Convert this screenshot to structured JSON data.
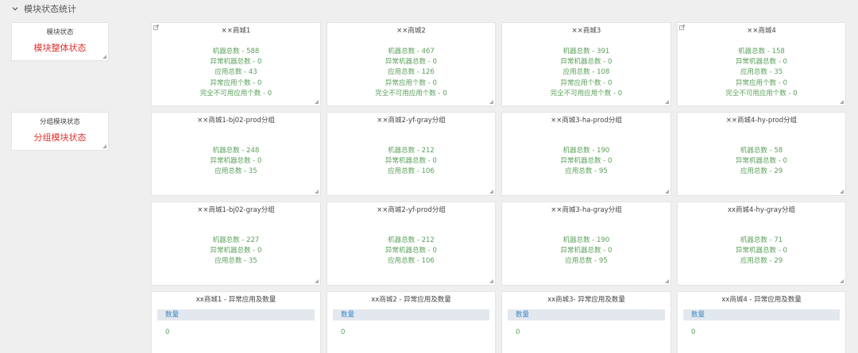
{
  "section": {
    "title": "模块状态统计"
  },
  "sidebar": [
    {
      "title": "模块状态",
      "value": "模块整体状态"
    },
    {
      "title": "分组模块状态",
      "value": "分组模块状态"
    }
  ],
  "row1": [
    {
      "title": "××商城1",
      "stats": [
        "机器总数 - 588",
        "异常机器总数 - 0",
        "应用总数 - 43",
        "异常应用个数 - 0",
        "完全不可用应用个数 - 0"
      ]
    },
    {
      "title": "××商城2",
      "stats": [
        "机器总数 - 467",
        "异常机器总数 - 0",
        "应用总数 - 126",
        "异常应用个数 - 0",
        "完全不可用应用个数 - 0"
      ]
    },
    {
      "title": "××商城3",
      "stats": [
        "机器总数 - 391",
        "异常机器总数 - 0",
        "应用总数 - 108",
        "异常应用个数 - 0",
        "完全不可用应用个数 - 0"
      ]
    },
    {
      "title": "××商城4",
      "stats": [
        "机器总数 - 158",
        "异常机器总数 - 0",
        "应用总数 - 35",
        "异常应用个数 - 0",
        "完全不可用应用个数 - 0"
      ]
    }
  ],
  "row2": [
    {
      "title": "××商城1-bj02-prod分组",
      "stats": [
        "机器总数 - 248",
        "异常机器总数 - 0",
        "应用总数 - 35"
      ]
    },
    {
      "title": "××商城2-yf-gray分组",
      "stats": [
        "机器总数 - 212",
        "异常机器总数 - 0",
        "应用总数 - 106"
      ]
    },
    {
      "title": "××商城3-ha-prod分组",
      "stats": [
        "机器总数 - 190",
        "异常机器总数 - 0",
        "应用总数 - 95"
      ]
    },
    {
      "title": "××商城4-hy-prod分组",
      "stats": [
        "机器总数 - 58",
        "异常机器总数 - 0",
        "应用总数 - 29"
      ]
    }
  ],
  "row3": [
    {
      "title": "××商城1-bj02-gray分组",
      "stats": [
        "机器总数 - 227",
        "异常机器总数 - 0",
        "应用总数 - 35"
      ]
    },
    {
      "title": "××商城2-yf-prod分组",
      "stats": [
        "机器总数 - 212",
        "异常机器总数 - 0",
        "应用总数 - 106"
      ]
    },
    {
      "title": "××商城3-ha-gray分组",
      "stats": [
        "机器总数 - 190",
        "异常机器总数 - 0",
        "应用总数 - 95"
      ]
    },
    {
      "title": "xx商城4-hy-gray分组",
      "stats": [
        "机器总数 - 71",
        "异常机器总数 - 0",
        "应用总数 - 29"
      ]
    }
  ],
  "row4": [
    {
      "title": "xx商城1 - 异常应用及数量",
      "column": "数量",
      "value": "0"
    },
    {
      "title": "xx商城2 - 异常应用及数量",
      "column": "数量",
      "value": "0"
    },
    {
      "title": "xx商城3- 异常应用及数量",
      "column": "数量",
      "value": "0"
    },
    {
      "title": "xx商城4 - 异常应用及数量",
      "column": "数量",
      "value": "0"
    }
  ]
}
